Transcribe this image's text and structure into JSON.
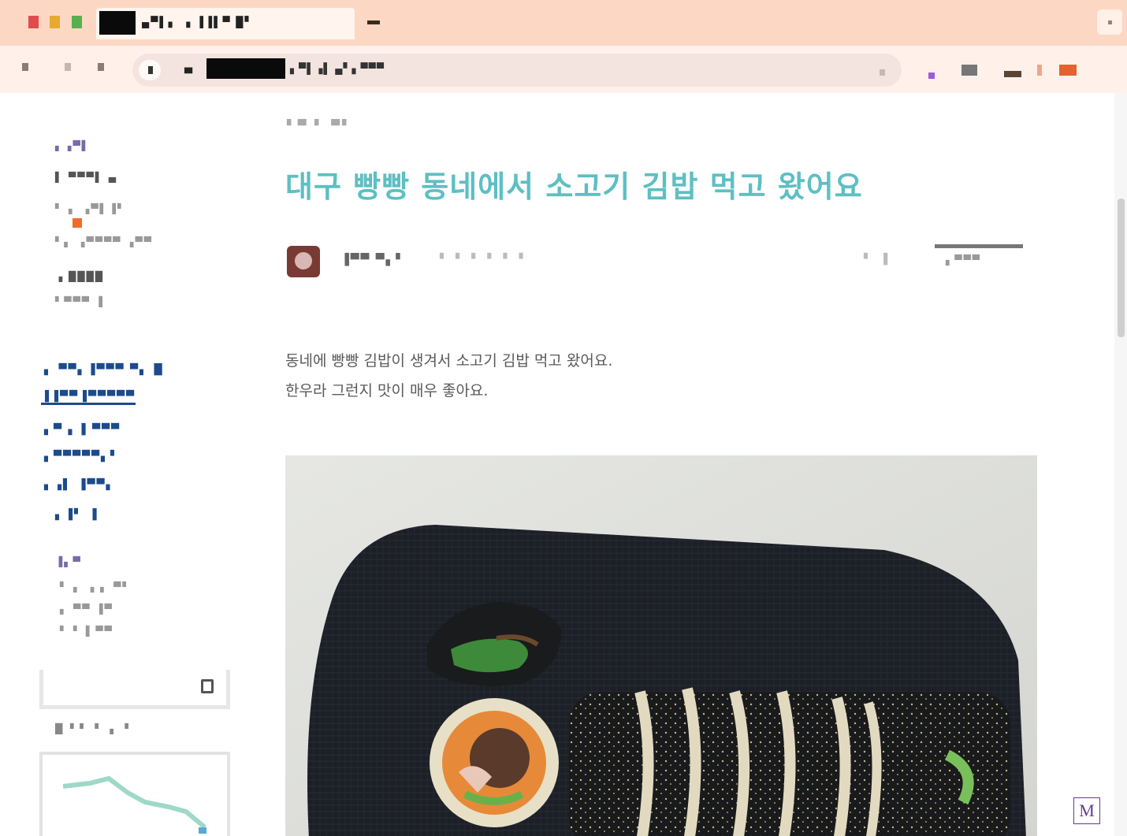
{
  "browser": {
    "tab_title": "▄▀▌▖ ▗ ▐▐▌▀ █▘",
    "url_prefix": "▄",
    "url_text": "▖▀▌▗▌ ▄▘▖▀▀▀",
    "icons": {
      "back": "back-icon",
      "forward": "forward-icon",
      "reload": "reload-icon",
      "site_info": "site-info-icon",
      "bookmark": "star-icon",
      "close_tab": "close-icon"
    }
  },
  "sidebar": {
    "profile_section": {
      "heading": "▖▗▀▌",
      "links": [
        "▌ ▀▀▀▌ ▄",
        "▘ ▖ ▗▀▌▐▘",
        "▘▖ ▗▀▀▀▀ ▗▀▀",
        "▗ ████",
        "▘▀▀▀ ▐"
      ]
    },
    "category_links": [
      "▖ ▀▀▖▐▀▀▀ ▀▖ █",
      "▐▐▀▀▐▀▀▀▀▀",
      "▖▀ ▖▐   ▀▀▀",
      "▖▀▀▀▀▀▖▘",
      "▖▗▌ ▐▀▀▖",
      "▖▐▘ ▐"
    ],
    "tags_section": {
      "heading": "▐▖▀",
      "links": [
        "▘ ▖ ▗ ▖ ▀▘",
        "▖ ▀▀ ▐▀",
        "▘ ▘▐ ▀▀"
      ]
    },
    "search": {
      "placeholder": "",
      "icon": "search-icon"
    },
    "calendar_caption": "█ ▘▘ ▘ ▖ ▘"
  },
  "post": {
    "category": "▘▀ ▘ ▀▘",
    "title": "대구 빵빵 동네에서 소고기 김밥 먹고 왔어요",
    "author": "▐▀▀ ▀▖▘",
    "date": "▘ ▘ ▘ ▘ ▘ ▘",
    "meta_link": "▘ ▐",
    "meta_button": "▖▀▀▀",
    "paragraphs": [
      "동네에 빵빵 김밥이 생겨서 소고기 김밥 먹고 왔어요.",
      "한우라 그런지 맛이 매우 좋아요."
    ],
    "photo_subject": "kimbap-photo"
  },
  "floating_logo": "M",
  "colors": {
    "titlebar": "#fcd8c4",
    "toolbar": "#fff1ea",
    "title_accent": "#5dbfc3",
    "sidebar_link": "#1c4b8c",
    "badge": "#f26b2a"
  }
}
